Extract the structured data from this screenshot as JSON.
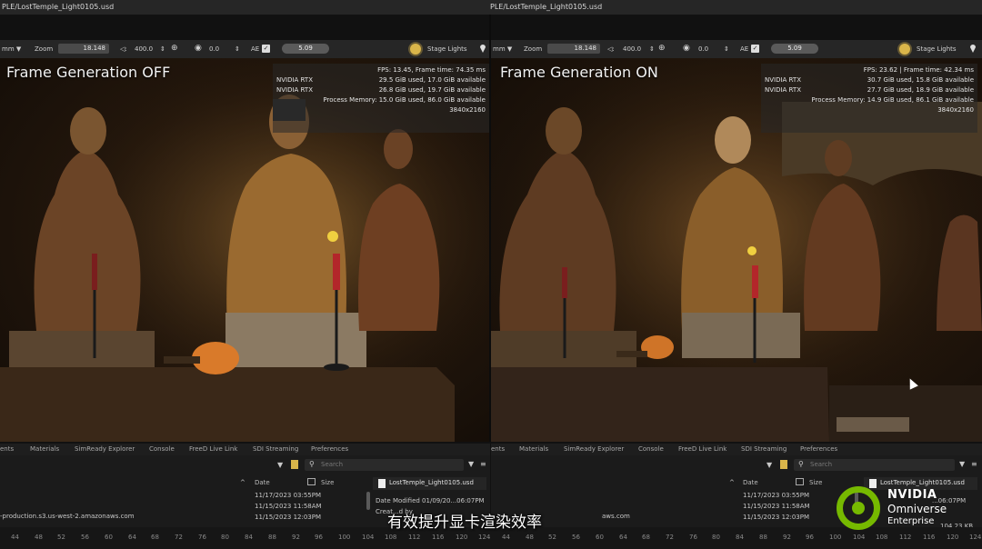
{
  "window": {
    "title_left": "PLE/LostTemple_Light0105.usd",
    "title_right": "PLE/LostTemple_Light0105.usd"
  },
  "toolbar": {
    "mode_left": "mm ▼",
    "mode_right": "mm ▼",
    "zoom_label": "Zoom",
    "zoom_value": "18.148",
    "focal_value": "400.0",
    "exposure_value": "0.0",
    "ae_label": "AE",
    "ae_checked": "✓",
    "fstop_value": "5.09",
    "stage_lights_label": "Stage Lights"
  },
  "left": {
    "label": "Frame Generation OFF",
    "fps_line": "FPS: 13.45, Frame time: 74.35 ms",
    "gpu1_name": "NVIDIA RTX",
    "gpu1_mem": "29.5 GiB used, 17.0 GiB available",
    "gpu2_name": "NVIDIA RTX",
    "gpu2_mem": "26.8 GiB used, 19.7 GiB available",
    "process_mem": "Process Memory: 15.0 GiB used, 86.0 GiB available",
    "resolution": "3840x2160"
  },
  "right": {
    "label": "Frame Generation ON",
    "fps_line": "FPS: 23.62 | Frame time: 42.34 ms",
    "gpu1_name": "NVIDIA RTX",
    "gpu1_mem": "30.7 GiB used, 15.8 GiB available",
    "gpu2_name": "NVIDIA RTX",
    "gpu2_mem": "27.7 GiB used, 18.9 GiB available",
    "process_mem": "Process Memory: 14.9 GiB used, 86.1 GiB available",
    "resolution": "3840x2160"
  },
  "tabs": {
    "t0": "ents",
    "t1": "Materials",
    "t2": "SimReady Explorer",
    "t3": "Console",
    "t4": "FreeD Live Link",
    "t5": "SDI Streaming",
    "t6": "Preferences"
  },
  "browser": {
    "search_placeholder": "Search",
    "col_date": "Date",
    "col_size": "Size",
    "dates_left": [
      "11/17/2023 03:55PM",
      "11/15/2023 11:58AM",
      "11/15/2023 12:03PM"
    ],
    "dates_right": [
      "11/17/2023 03:55PM",
      "11/15/2023 11:58AM",
      "11/15/2023 12:03PM"
    ],
    "server_left": "-production.s3.us-west-2.amazonaws.com",
    "server_right": "aws.com",
    "file_name": "LostTemple_Light0105.usd",
    "date_modified_left": "Date Modified 01/09/20...06:07PM",
    "date_modified_right": "...06:07PM",
    "created_left": "Creat...d by",
    "size_right": "104.23 KB"
  },
  "ruler": {
    "ticks": [
      "44",
      "48",
      "52",
      "56",
      "60",
      "64",
      "68",
      "72",
      "76",
      "80",
      "84",
      "88",
      "92",
      "96",
      "100",
      "104",
      "108",
      "112",
      "116",
      "120",
      "124",
      "44",
      "48",
      "52",
      "56",
      "60",
      "64",
      "68",
      "72",
      "76",
      "80",
      "84",
      "88",
      "92",
      "96",
      "100",
      "104",
      "108",
      "112",
      "116",
      "120",
      "124"
    ]
  },
  "subtitle": "有效提升显卡渲染效率",
  "logo": {
    "line1": "NVIDIA",
    "line2": "Omniverse",
    "line3": "Enterprise"
  },
  "colors": {
    "nvidia_green": "#76b900",
    "candle_red": "#b3262a",
    "lamp_yellow": "#f0d040"
  }
}
